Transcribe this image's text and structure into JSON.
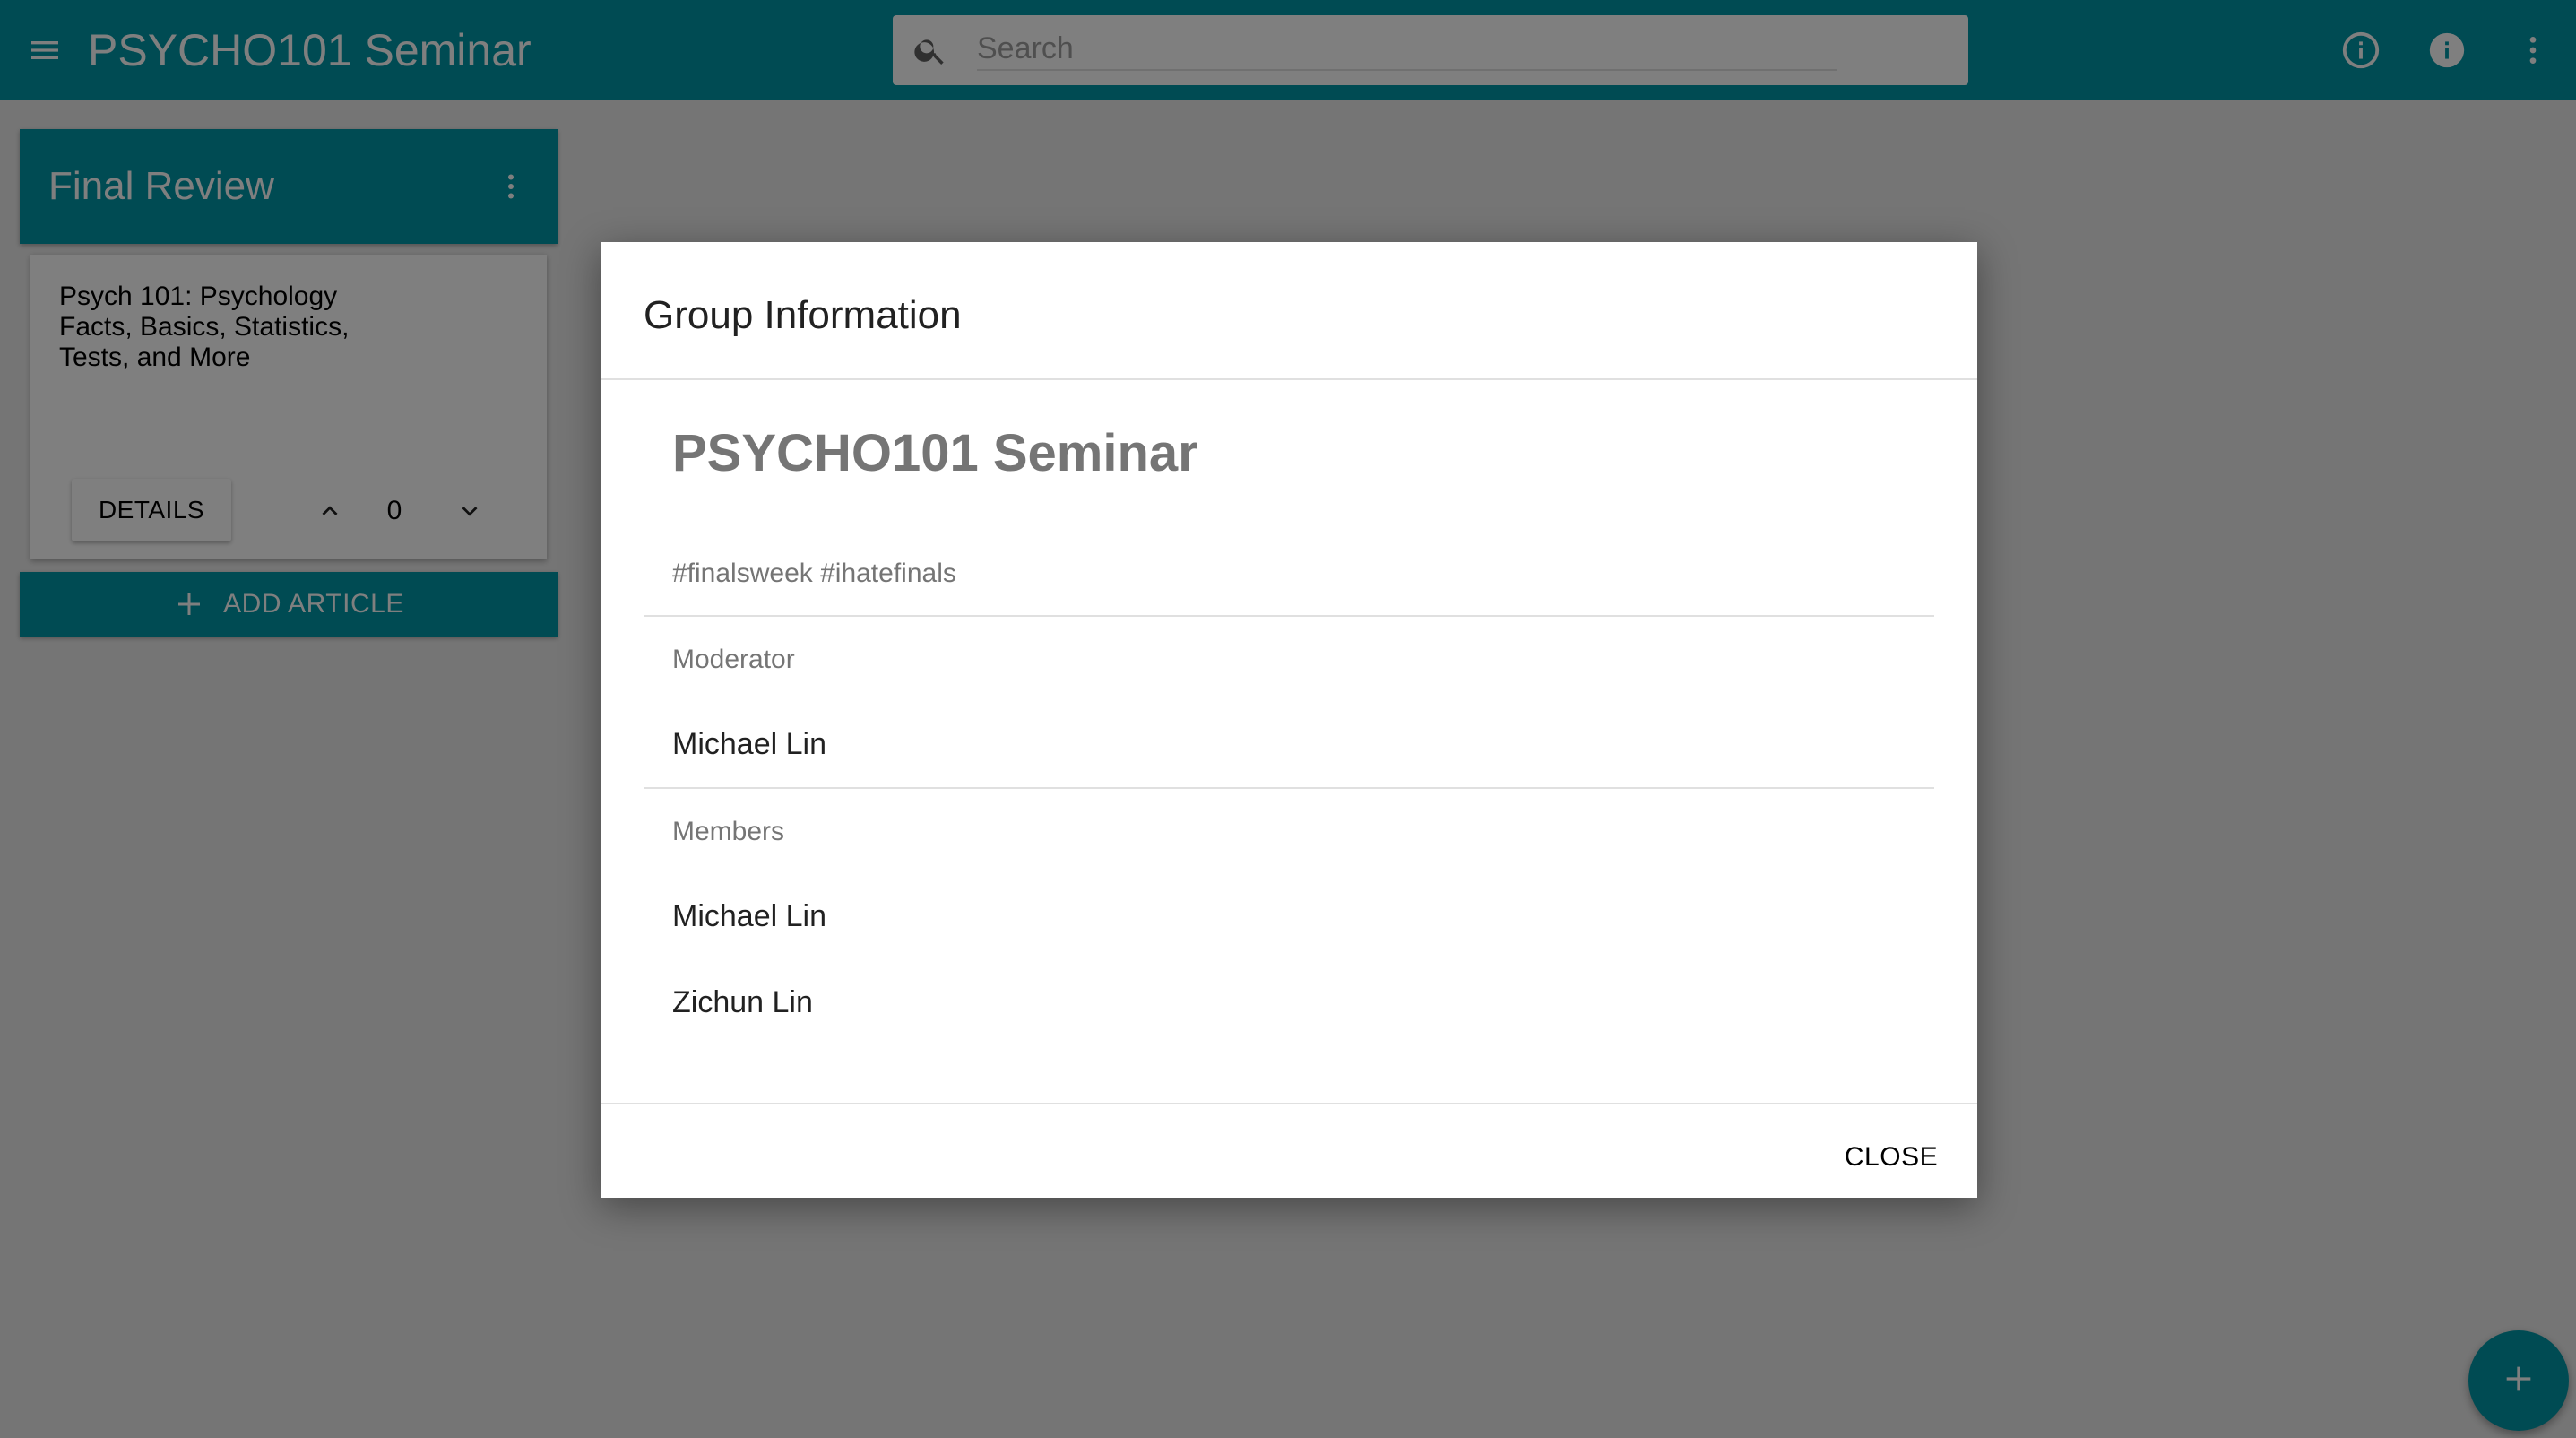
{
  "colors": {
    "primary": "#0097a7",
    "background": "#ebebeb",
    "overlay": "rgba(0,0,0,0.5)"
  },
  "appbar": {
    "menu_icon": "hamburger-menu-icon",
    "title": "PSYCHO101 Seminar",
    "search": {
      "icon": "search-icon",
      "placeholder": "Search",
      "value": ""
    },
    "actions": [
      {
        "icon": "info-outline-icon"
      },
      {
        "icon": "info-filled-icon"
      },
      {
        "icon": "more-vert-icon"
      }
    ]
  },
  "board": {
    "list": {
      "title": "Final Review",
      "menu_icon": "more-vert-icon",
      "articles": [
        {
          "title": "Psych 101: Psychology Facts, Basics, Statistics, Tests, and More",
          "details_label": "DETAILS",
          "upvote_icon": "chevron-up-icon",
          "votes": "0",
          "downvote_icon": "chevron-down-icon"
        }
      ],
      "add_article_label": "ADD ARTICLE",
      "add_icon": "plus-icon"
    }
  },
  "fab": {
    "icon": "plus-icon"
  },
  "dialog": {
    "title": "Group Information",
    "group_name": "PSYCHO101 Seminar",
    "tags": "#finalsweek #ihatefinals",
    "moderator_label": "Moderator",
    "moderator": "Michael Lin",
    "members_label": "Members",
    "members": [
      "Michael Lin",
      "Zichun Lin"
    ],
    "close_label": "CLOSE"
  }
}
